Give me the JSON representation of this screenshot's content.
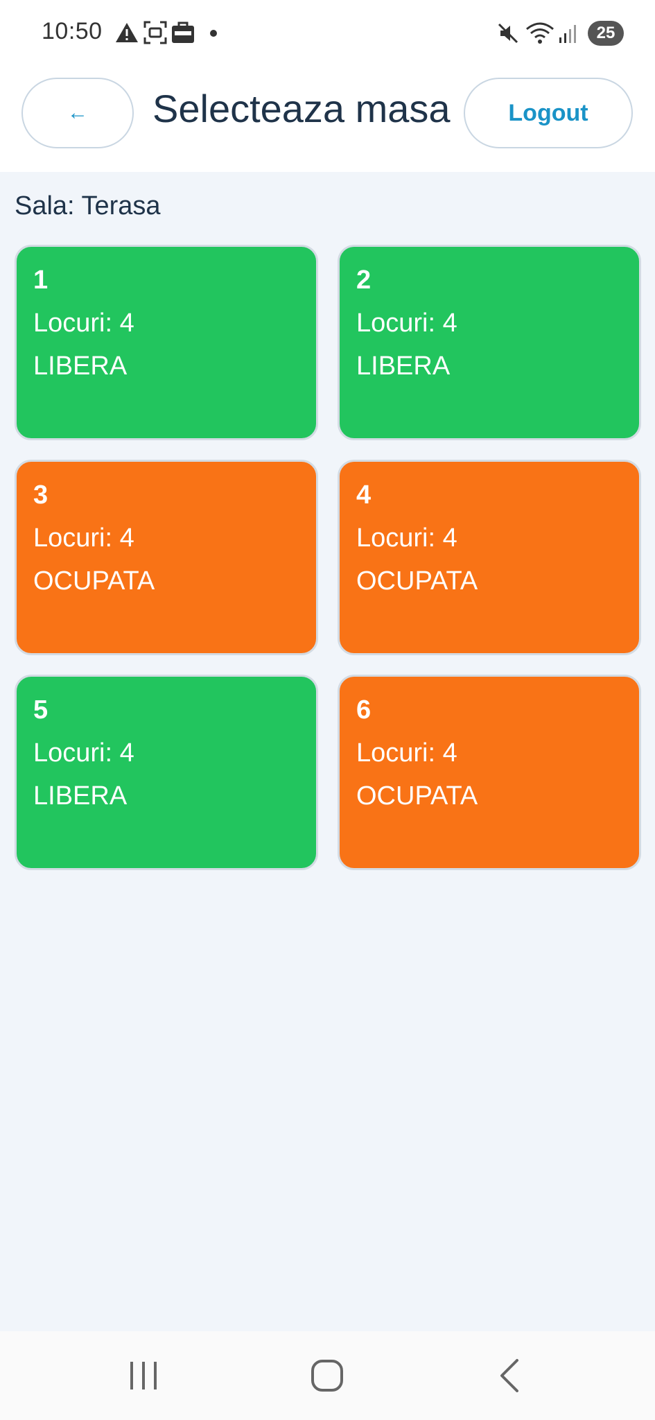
{
  "status_bar": {
    "time": "10:50",
    "icons": [
      "warning-icon",
      "screenshot-icon",
      "emag-app-icon",
      "notification-dot-icon",
      "mute-icon",
      "wifi-icon",
      "signal-icon"
    ],
    "battery": "25"
  },
  "header": {
    "back_label": "←",
    "title": "Selecteaza masa",
    "logout_label": "Logout"
  },
  "room": {
    "label": "Sala: Terasa"
  },
  "tables": [
    {
      "number": "1",
      "seats": "Locuri: 4",
      "status": "LIBERA"
    },
    {
      "number": "2",
      "seats": "Locuri: 4",
      "status": "LIBERA"
    },
    {
      "number": "3",
      "seats": "Locuri: 4",
      "status": "OCUPATA"
    },
    {
      "number": "4",
      "seats": "Locuri: 4",
      "status": "OCUPATA"
    },
    {
      "number": "5",
      "seats": "Locuri: 4",
      "status": "LIBERA"
    },
    {
      "number": "6",
      "seats": "Locuri: 4",
      "status": "OCUPATA"
    }
  ],
  "colors": {
    "free": "#22c55e",
    "occupied": "#f97316",
    "accent": "#1a93c7",
    "title": "#1f3349",
    "background": "#f1f5fa"
  },
  "nav_bar": {
    "icons": [
      "recent-apps-icon",
      "home-icon",
      "back-icon"
    ]
  }
}
